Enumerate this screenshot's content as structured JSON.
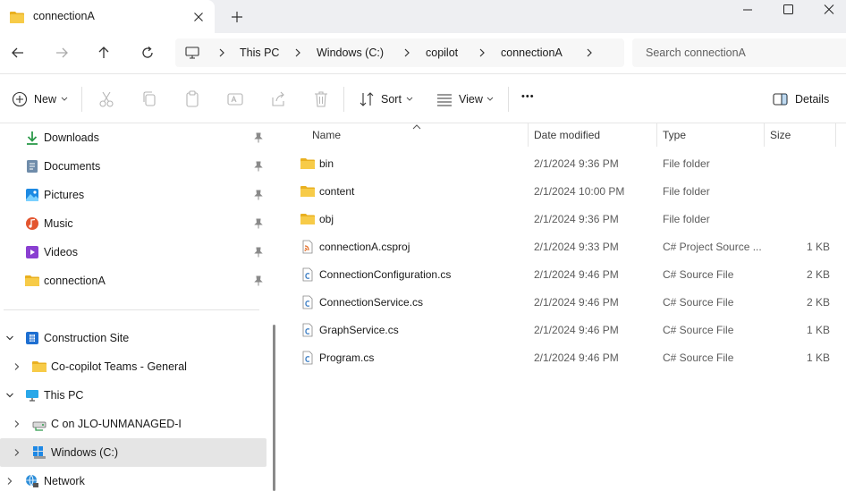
{
  "window": {
    "tab_title": "connectionA"
  },
  "address": {
    "crumbs": [
      "This PC",
      "Windows (C:)",
      "copilot",
      "connectionA"
    ],
    "search_placeholder": "Search connectionA"
  },
  "toolbar": {
    "new_label": "New",
    "sort_label": "Sort",
    "view_label": "View",
    "more_label": "•••",
    "details_label": "Details"
  },
  "nav": {
    "quick_access": [
      {
        "label": "Downloads",
        "icon": "download-icon"
      },
      {
        "label": "Documents",
        "icon": "documents-icon"
      },
      {
        "label": "Pictures",
        "icon": "pictures-icon"
      },
      {
        "label": "Music",
        "icon": "music-icon"
      },
      {
        "label": "Videos",
        "icon": "videos-icon"
      },
      {
        "label": "connectionA",
        "icon": "folder-icon"
      }
    ],
    "tree": [
      {
        "label": "Construction Site",
        "icon": "building-icon",
        "expanded": true
      },
      {
        "label": "Co-copilot Teams - General",
        "icon": "folder-icon",
        "expanded": false
      },
      {
        "label": "This PC",
        "icon": "pc-icon",
        "expanded": true
      },
      {
        "label": "C on JLO-UNMANAGED-I",
        "icon": "network-drive-icon",
        "expanded": false
      },
      {
        "label": "Windows (C:)",
        "icon": "windows-drive-icon",
        "expanded": false,
        "selected": true
      },
      {
        "label": "Network",
        "icon": "network-icon",
        "expanded": false
      }
    ]
  },
  "files": {
    "columns": {
      "name": "Name",
      "date": "Date modified",
      "type": "Type",
      "size": "Size"
    },
    "rows": [
      {
        "name": "bin",
        "date": "2/1/2024 9:36 PM",
        "type": "File folder",
        "size": "",
        "icon": "folder-icon"
      },
      {
        "name": "content",
        "date": "2/1/2024 10:00 PM",
        "type": "File folder",
        "size": "",
        "icon": "folder-icon"
      },
      {
        "name": "obj",
        "date": "2/1/2024 9:36 PM",
        "type": "File folder",
        "size": "",
        "icon": "folder-icon"
      },
      {
        "name": "connectionA.csproj",
        "date": "2/1/2024 9:33 PM",
        "type": "C# Project Source ...",
        "size": "1 KB",
        "icon": "csproj-file-icon"
      },
      {
        "name": "ConnectionConfiguration.cs",
        "date": "2/1/2024 9:46 PM",
        "type": "C# Source File",
        "size": "2 KB",
        "icon": "cs-file-icon"
      },
      {
        "name": "ConnectionService.cs",
        "date": "2/1/2024 9:46 PM",
        "type": "C# Source File",
        "size": "2 KB",
        "icon": "cs-file-icon"
      },
      {
        "name": "GraphService.cs",
        "date": "2/1/2024 9:46 PM",
        "type": "C# Source File",
        "size": "1 KB",
        "icon": "cs-file-icon"
      },
      {
        "name": "Program.cs",
        "date": "2/1/2024 9:46 PM",
        "type": "C# Source File",
        "size": "1 KB",
        "icon": "cs-file-icon"
      }
    ]
  },
  "colors": {
    "folder": "#f4c542",
    "accent": "#0067c0",
    "selected_bg": "#e5e5e5",
    "titlebar_bg": "#eeeff2"
  }
}
